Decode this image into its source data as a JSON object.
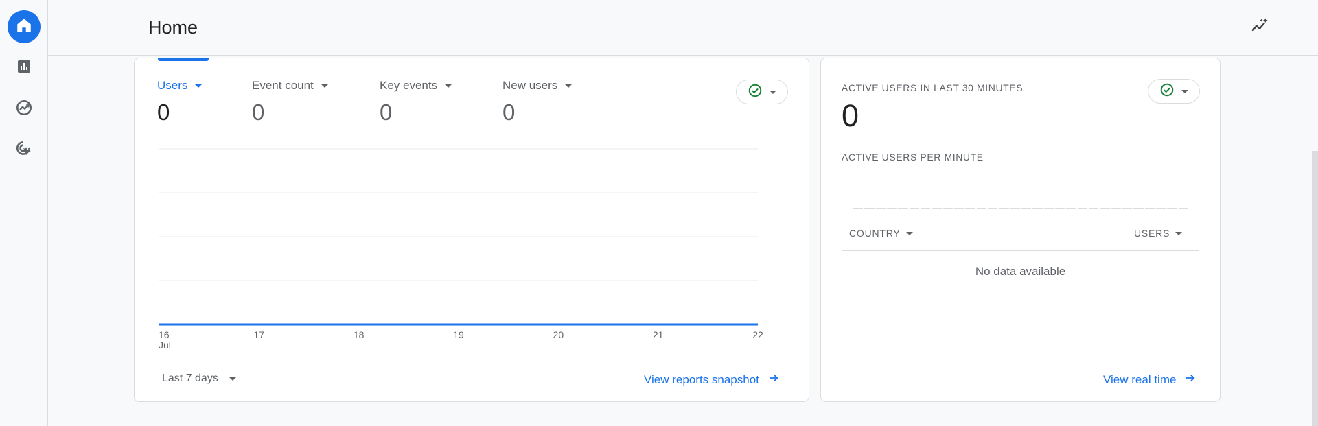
{
  "header": {
    "title": "Home"
  },
  "nav": {
    "items": [
      {
        "icon": "home-icon",
        "active": true
      },
      {
        "icon": "reports-icon",
        "active": false
      },
      {
        "icon": "explore-icon",
        "active": false
      },
      {
        "icon": "advertising-icon",
        "active": false
      }
    ]
  },
  "overview": {
    "metrics": [
      {
        "label": "Users",
        "value": "0",
        "selected": true
      },
      {
        "label": "Event count",
        "value": "0",
        "selected": false
      },
      {
        "label": "Key events",
        "value": "0",
        "selected": false
      },
      {
        "label": "New users",
        "value": "0",
        "selected": false
      }
    ],
    "date_range": "Last 7 days",
    "link": "View reports snapshot"
  },
  "chart_data": {
    "type": "line",
    "x": [
      "16 Jul",
      "17",
      "18",
      "19",
      "20",
      "21",
      "22"
    ],
    "series": [
      {
        "values": [
          0,
          0,
          0,
          0,
          0,
          0,
          0
        ]
      }
    ],
    "grid": true,
    "color": "#1a73e8"
  },
  "realtime": {
    "title": "ACTIVE USERS IN LAST 30 MINUTES",
    "value": "0",
    "per_minute_label": "ACTIVE USERS PER MINUTE",
    "columns": [
      "COUNTRY",
      "USERS"
    ],
    "empty_text": "No data available",
    "link": "View real time"
  },
  "colors": {
    "accent": "#1a73e8",
    "status_ok": "#188038"
  }
}
